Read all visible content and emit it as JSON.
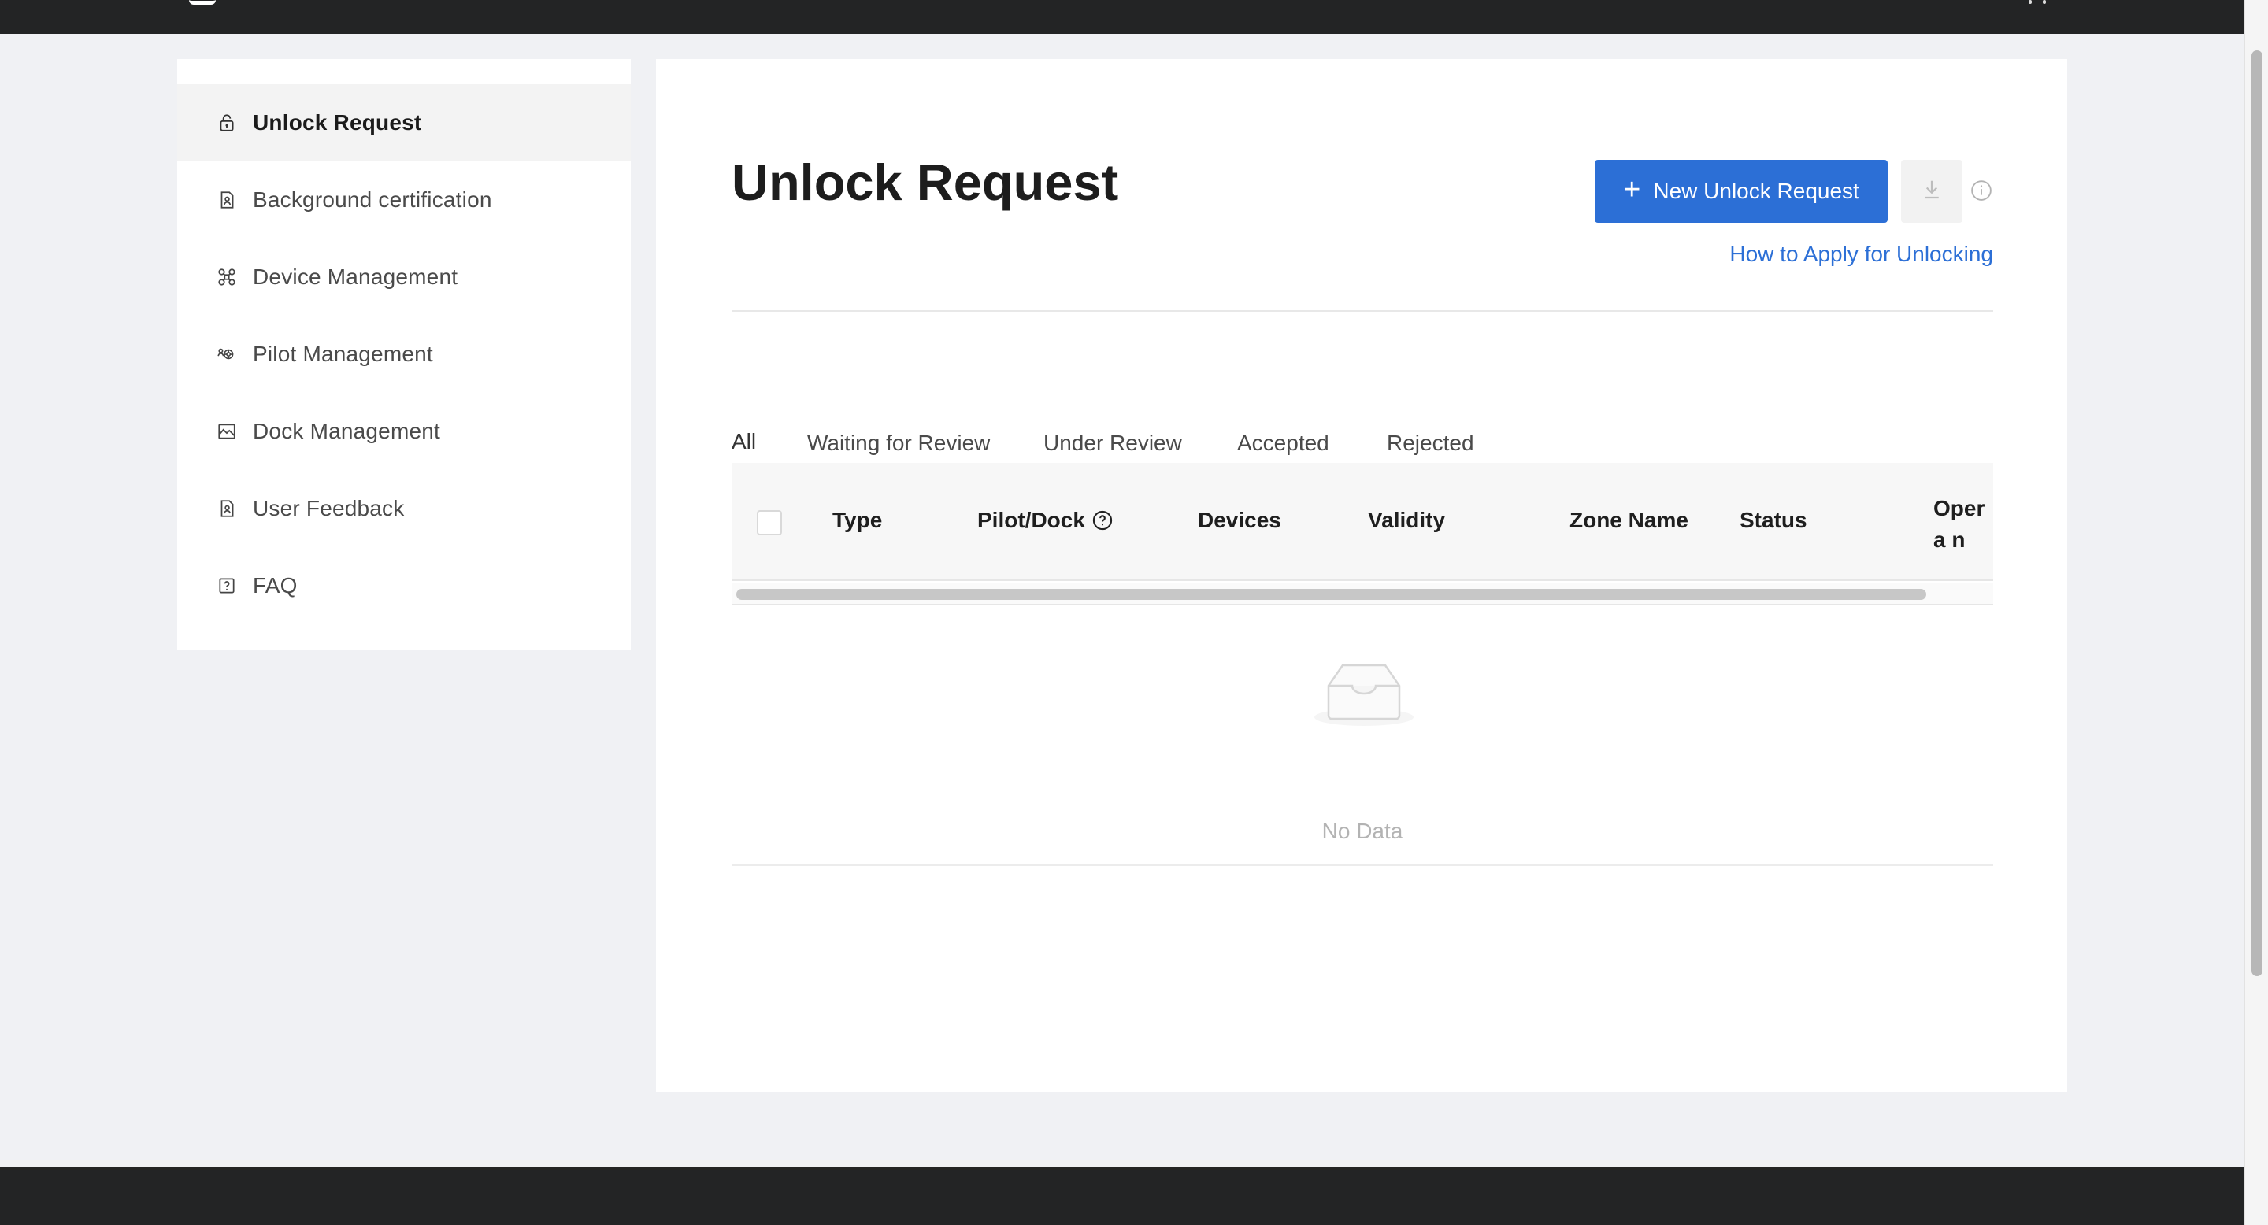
{
  "sidebar": {
    "items": [
      {
        "label": "Unlock Request",
        "icon": "lock-icon",
        "active": true
      },
      {
        "label": "Background certification",
        "icon": "document-person-icon"
      },
      {
        "label": "Device Management",
        "icon": "drone-icon"
      },
      {
        "label": "Pilot Management",
        "icon": "pilots-icon"
      },
      {
        "label": "Dock Management",
        "icon": "dock-image-icon"
      },
      {
        "label": "User Feedback",
        "icon": "feedback-icon"
      },
      {
        "label": "FAQ",
        "icon": "question-square-icon"
      }
    ]
  },
  "main": {
    "title": "Unlock Request",
    "new_button": {
      "plus": "+",
      "label": "New Unlock Request"
    },
    "help_link": "How to Apply for Unlocking",
    "tabs": [
      {
        "label": "All",
        "active": true
      },
      {
        "label": "Waiting for Review"
      },
      {
        "label": "Under Review"
      },
      {
        "label": "Accepted"
      },
      {
        "label": "Rejected"
      }
    ],
    "table": {
      "columns": [
        "Type",
        "Pilot/Dock",
        "Devices",
        "Validity",
        "Zone Name",
        "Status",
        "Operation"
      ],
      "operation_visible": "Opera n",
      "empty_text": "No Data"
    }
  },
  "colors": {
    "primary": "#2c6fd6",
    "topbar": "#232425",
    "background": "#f0f1f4"
  }
}
